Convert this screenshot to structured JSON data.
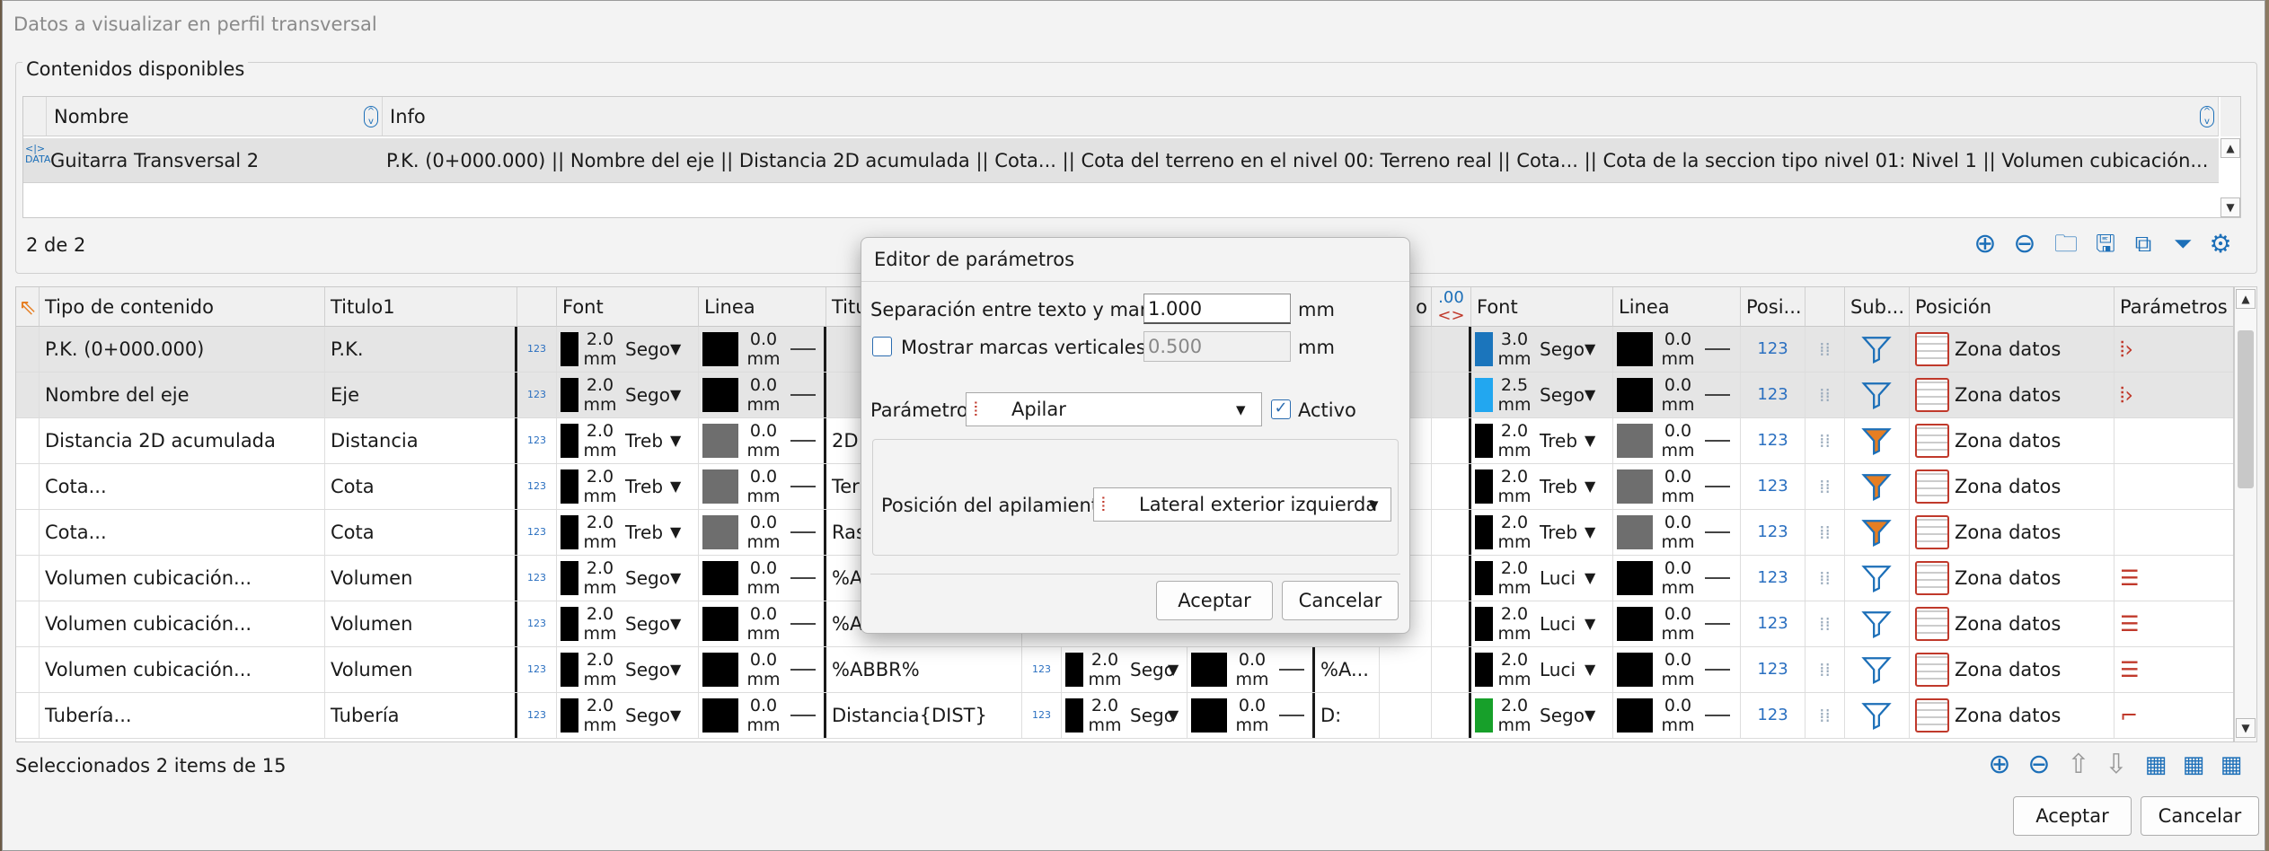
{
  "window_title": "Datos a visualizar en perfil transversal",
  "available": {
    "group_label": "Contenidos disponibles",
    "col_name": "Nombre",
    "col_info": "Info",
    "row": {
      "icon_text": "DATA",
      "name": "Guitarra Transversal 2",
      "info": "P.K. (0+000.000) || Nombre del eje || Distancia 2D acumulada || Cota... || Cota del terreno en el nivel 00: Terreno real || Cota... || Cota de la seccion tipo nivel 01: Nivel 1 || Volumen cubicación... |..."
    },
    "count": "2 de 2"
  },
  "grid": {
    "headers": {
      "tipo": "Tipo de contenido",
      "titulo1": "Titulo1",
      "font": "Font",
      "linea": "Linea",
      "titulo2": "Titulo",
      "o": "o",
      "dec": ".00",
      "font2": "Font",
      "linea2": "Linea",
      "posi": "Posi...",
      "sub": "Sub...",
      "posicion": "Posición",
      "parametros": "Parámetros"
    },
    "rows": [
      {
        "tipo": "P.K. (0+000.000)",
        "titulo": "P.K.",
        "size": "2.0",
        "unit": "mm",
        "font": "Sego",
        "lw": "0.0",
        "t2": "",
        "size2": "3.0",
        "font2": "Sego",
        "sel": true
      },
      {
        "tipo": "Nombre del eje",
        "titulo": "Eje",
        "size": "2.0",
        "unit": "mm",
        "font": "Sego",
        "lw": "0.0",
        "t2": "",
        "size2": "2.5",
        "font2": "Sego",
        "sel": true
      },
      {
        "tipo": "Distancia 2D acumulada",
        "titulo": "Distancia",
        "size": "2.0",
        "unit": "mm",
        "font": "Treb",
        "lw": "0.0",
        "t2": "2D",
        "size2": "2.0",
        "font2": "Treb",
        "sel": false
      },
      {
        "tipo": "Cota...",
        "titulo": "Cota",
        "size": "2.0",
        "unit": "mm",
        "font": "Treb",
        "lw": "0.0",
        "t2": "Terren",
        "size2": "2.0",
        "font2": "Treb",
        "sel": false
      },
      {
        "tipo": "Cota...",
        "titulo": "Cota",
        "size": "2.0",
        "unit": "mm",
        "font": "Treb",
        "lw": "0.0",
        "t2": "Rasan",
        "size2": "2.0",
        "font2": "Treb",
        "sel": false
      },
      {
        "tipo": "Volumen cubicación...",
        "titulo": "Volumen",
        "size": "2.0",
        "unit": "mm",
        "font": "Sego",
        "lw": "0.0",
        "t2": "%ABBR",
        "size2": "2.0",
        "font2": "Luci",
        "sel": false
      },
      {
        "tipo": "Volumen cubicación...",
        "titulo": "Volumen",
        "size": "2.0",
        "unit": "mm",
        "font": "Sego",
        "lw": "0.0",
        "t2": "%ABBR",
        "size2": "2.0",
        "font2": "Luci",
        "sel": false
      },
      {
        "tipo": "Volumen cubicación...",
        "titulo": "Volumen",
        "size": "2.0",
        "unit": "mm",
        "font": "Sego",
        "lw": "0.0",
        "t2": "%ABBR%",
        "t3": "2.0",
        "t4": "0.0",
        "t5": "%A...",
        "size2": "2.0",
        "font2": "Luci",
        "sel": false
      },
      {
        "tipo": "Tubería...",
        "titulo": "Tubería",
        "size": "2.0",
        "unit": "mm",
        "font": "Sego",
        "lw": "0.0",
        "t2": "Distancia{DIST}",
        "t3": "2.0",
        "t4": "0.0",
        "t5": "D:",
        "size2": "2.0",
        "font2": "Sego",
        "sel": false
      }
    ],
    "zona": "Zona datos",
    "pos_icon": "123",
    "swatch2_colors": [
      "#1b75bc",
      "#22a7f0",
      "#000000",
      "#000000",
      "#000000",
      "#000000",
      "#000000",
      "#000000",
      "#17a02a"
    ]
  },
  "status": "Seleccionados 2 items de 15",
  "buttons": {
    "accept": "Aceptar",
    "cancel": "Cancelar"
  },
  "dialog": {
    "title": "Editor de parámetros",
    "sep_label": "Separación entre texto y marco:",
    "sep_value": "1.000",
    "unit": "mm",
    "marks_label": "Mostrar marcas verticales",
    "marks_value": "0.500",
    "param_label": "Parámetro:",
    "param_value": "Apilar",
    "active_label": "Activo",
    "stack_label": "Posición del apilamiento:",
    "stack_value": "Lateral exterior izquierda",
    "accept": "Aceptar",
    "cancel": "Cancelar"
  }
}
